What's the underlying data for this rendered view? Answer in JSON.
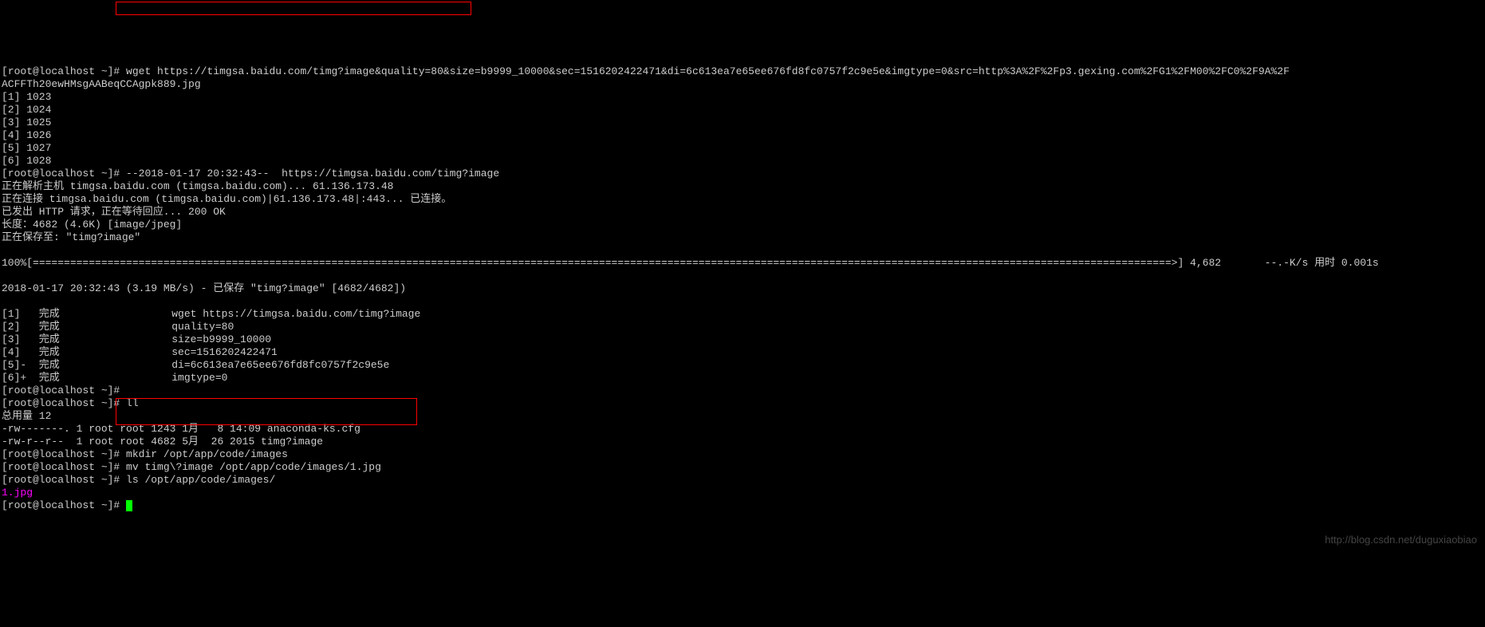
{
  "prompt": "[root@localhost ~]#",
  "wget_cmd": "wget https://timgsa.baidu.com/timg?image&quality=80&size=b9999_10000&sec=1516202422471&di=6c613ea7e65ee676fd8fc0757f2c9e5e&imgtype=0&src=http%3A%2F%2Fp3.gexing.com%2FG1%2FM00%2FC0%2F9A%2F",
  "wget_cmd_wrap": "ACFFTh20ewHMsgAABeqCCAgpk889.jpg",
  "bg_jobs": [
    "[1] 1023",
    "[2] 1024",
    "[3] 1025",
    "[4] 1026",
    "[5] 1027",
    "[6] 1028"
  ],
  "wget_time": "--2018-01-17 20:32:43--  https://timgsa.baidu.com/timg?image",
  "resolve": "正在解析主机 timgsa.baidu.com (timgsa.baidu.com)... 61.136.173.48",
  "connect": "正在连接 timgsa.baidu.com (timgsa.baidu.com)|61.136.173.48|:443... 已连接。",
  "http_req": "已发出 HTTP 请求，正在等待回应... 200 OK",
  "length": "长度：4682 (4.6K) [image/jpeg]",
  "saving": "正在保存至: \"timg?image\"",
  "progress_pre": "100%[",
  "progress_bar": "=======================================================================================================================================================================================>",
  "progress_post": "] 4,682       --.-K/s 用时 0.001s",
  "saved": "2018-01-17 20:32:43 (3.19 MB/s) - 已保存 \"timg?image\" [4682/4682])",
  "done": [
    "[1]   完成                  wget https://timgsa.baidu.com/timg?image",
    "[2]   完成                  quality=80",
    "[3]   完成                  size=b9999_10000",
    "[4]   完成                  sec=1516202422471",
    "[5]-  完成                  di=6c613ea7e65ee676fd8fc0757f2c9e5e",
    "[6]+  完成                  imgtype=0"
  ],
  "ll_cmd": "ll",
  "ll_total": "总用量 12",
  "ll_rows": [
    "-rw-------. 1 root root 1243 1月   8 14:09 anaconda-ks.cfg",
    "-rw-r--r--  1 root root 4682 5月  26 2015 timg?image"
  ],
  "mkdir_cmd": "mkdir /opt/app/code/images",
  "mv_cmd": "mv timg\\?image /opt/app/code/images/1.jpg",
  "ls_cmd": "ls /opt/app/code/images/",
  "ls_out": "1.jpg",
  "watermark": "http://blog.csdn.net/duguxiaobiao"
}
